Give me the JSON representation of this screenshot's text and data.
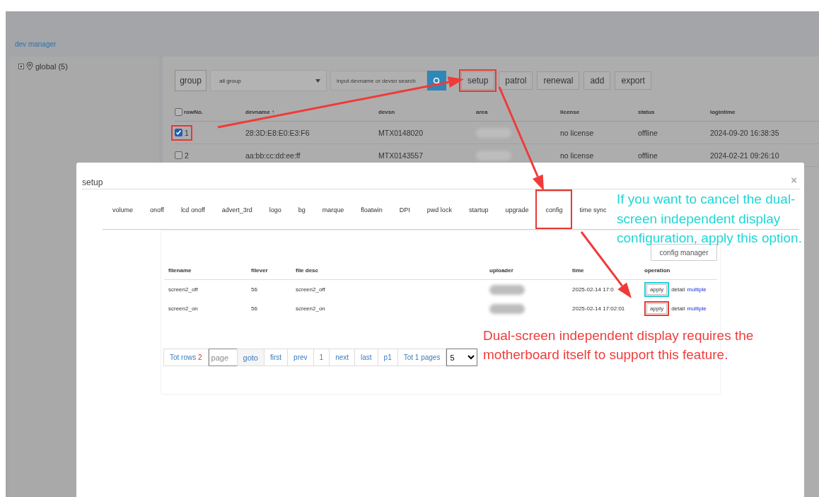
{
  "app": {
    "title": "dev manager"
  },
  "tree": [
    {
      "label": "global (5)",
      "expanded": false
    }
  ],
  "toolbar": {
    "group_label": "group",
    "group_select": "all group",
    "search_placeholder": "input devname or devsn search",
    "buttons": [
      {
        "label": "setup",
        "highlighted": true
      },
      {
        "label": "patrol",
        "highlighted": false
      },
      {
        "label": "renewal",
        "highlighted": false
      },
      {
        "label": "add",
        "highlighted": false
      },
      {
        "label": "export",
        "highlighted": false
      }
    ]
  },
  "table": {
    "select_all": false,
    "columns": [
      "rowNo.",
      "devname ↑",
      "devsn",
      "area",
      "license",
      "status",
      "logintime"
    ],
    "rows": [
      {
        "selected": true,
        "highlighted": true,
        "row_no": "1",
        "devname": "28:3D:E8:E0:E3:F6",
        "devsn": "MTX0148020",
        "license": "no license",
        "status": "offline",
        "logintime": "2024-09-20 16:38:35"
      },
      {
        "selected": false,
        "highlighted": false,
        "row_no": "2",
        "devname": "aa:bb:cc:dd:ee:ff",
        "devsn": "MTX0143557",
        "license": "no license",
        "status": "offline",
        "logintime": "2024-02-21 09:26:10"
      }
    ]
  },
  "dialog": {
    "title": "setup",
    "close": "×",
    "tabs": [
      {
        "label": "volume",
        "selected": false,
        "highlighted": false
      },
      {
        "label": "onoff",
        "selected": false,
        "highlighted": false
      },
      {
        "label": "lcd onoff",
        "selected": false,
        "highlighted": false
      },
      {
        "label": "advert_3rd",
        "selected": false,
        "highlighted": false
      },
      {
        "label": "logo",
        "selected": false,
        "highlighted": false
      },
      {
        "label": "bg",
        "selected": false,
        "highlighted": false
      },
      {
        "label": "marque",
        "selected": false,
        "highlighted": false
      },
      {
        "label": "floatwin",
        "selected": false,
        "highlighted": false
      },
      {
        "label": "DPI",
        "selected": false,
        "highlighted": false
      },
      {
        "label": "pwd lock",
        "selected": false,
        "highlighted": false
      },
      {
        "label": "startup",
        "selected": false,
        "highlighted": false
      },
      {
        "label": "upgrade",
        "selected": false,
        "highlighted": false
      },
      {
        "label": "config",
        "selected": true,
        "highlighted": true
      },
      {
        "label": "time sync",
        "selected": false,
        "highlighted": false
      }
    ],
    "config_manager": "config manager",
    "files": {
      "columns": [
        "filename",
        "filever",
        "file desc",
        "uploader",
        "time",
        "operation"
      ],
      "rows": [
        {
          "filename": "screen2_off",
          "filever": "56",
          "file_desc": "screen2_off",
          "time": "2025-02-14 17:0",
          "actions": [
            {
              "kind": "button",
              "label": "apply",
              "color": "#22d0d6"
            },
            {
              "kind": "text",
              "label": "detail"
            },
            {
              "kind": "link",
              "label": "multiple"
            }
          ]
        },
        {
          "filename": "screen2_on",
          "filever": "56",
          "file_desc": "screen2_on",
          "time": "2025-02-14 17:02:01",
          "actions": [
            {
              "kind": "button",
              "label": "apply",
              "color": "#e83a3a"
            },
            {
              "kind": "text",
              "label": "detail"
            },
            {
              "kind": "link",
              "label": "multiple"
            }
          ]
        }
      ]
    },
    "pagination": [
      {
        "kind": "total",
        "label": "Tot rows",
        "count": "2"
      },
      {
        "kind": "input",
        "placeholder": "page"
      },
      {
        "kind": "button",
        "label": "goto"
      },
      {
        "kind": "link",
        "label": "first"
      },
      {
        "kind": "link",
        "label": "prev"
      },
      {
        "kind": "link",
        "label": "1"
      },
      {
        "kind": "link",
        "label": "next"
      },
      {
        "kind": "link",
        "label": "last"
      },
      {
        "kind": "link",
        "label": "p1"
      },
      {
        "kind": "link",
        "label": "Tot 1 pages"
      },
      {
        "kind": "select",
        "value": "5"
      }
    ]
  },
  "annotations": [
    {
      "kind": "note-upper",
      "text": "If you want to cancel the dual-screen independent display configuration, apply this option.",
      "color": "#1fd6d6"
    },
    {
      "kind": "note-lower",
      "text": "Dual-screen independent display requires the motherboard itself to support this feature.",
      "color": "#f03c3c"
    }
  ]
}
